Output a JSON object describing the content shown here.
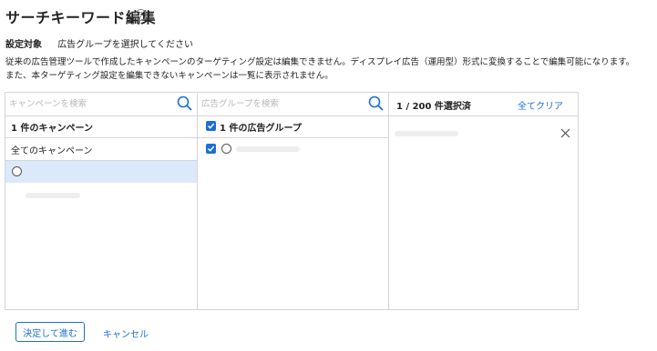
{
  "page": {
    "title": "サーチキーワード編集",
    "help_icon": "?"
  },
  "setting": {
    "label": "設定対象",
    "value": "広告グループを選択してください"
  },
  "notes": [
    "従来の広告管理ツールで作成したキャンペーンのターゲティング設定は編集できません。ディスプレイ広告（運用型）形式に変換することで編集可能になります。",
    "また、本ターゲティング設定を編集できないキャンペーンは一覧に表示されません。"
  ],
  "campaign_panel": {
    "search_placeholder": "キャンペーンを検索",
    "header": "1 件のキャンペーン",
    "all_label": "全てのキャンペーン"
  },
  "adgroup_panel": {
    "search_placeholder": "広告グループを検索",
    "header": "1 件の広告グループ"
  },
  "selected_panel": {
    "count": "1 / 200 件選択済",
    "clear_label": "全てクリア"
  },
  "footer": {
    "confirm_label": "決定して進む",
    "cancel_label": "キャンセル"
  },
  "colors": {
    "accent": "#1b6fd6",
    "selected_row": "#dce9fb",
    "border": "#d5d5d5"
  }
}
